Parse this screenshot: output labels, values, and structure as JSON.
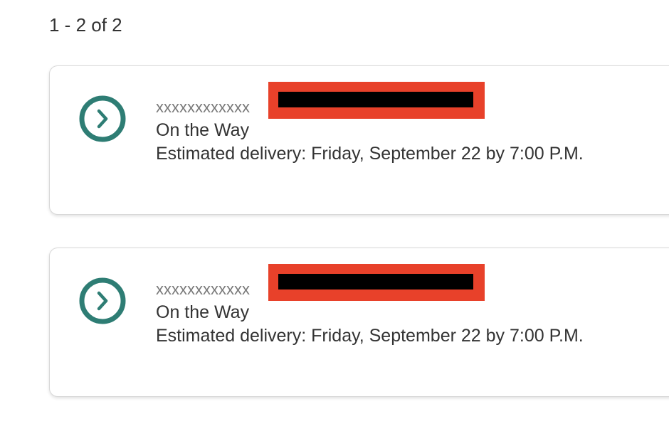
{
  "results": {
    "count_label": "1 - 2 of 2"
  },
  "shipments": [
    {
      "tracking_number": "xxxxxxxxxxxx",
      "status": "On the Way",
      "estimated_delivery": "Estimated delivery: Friday, September 22 by 7:00 P.M.",
      "open_icon": "chevron-right-circle-icon"
    },
    {
      "tracking_number": "xxxxxxxxxxxx",
      "status": "On the Way",
      "estimated_delivery": "Estimated delivery: Friday, September 22 by 7:00 P.M.",
      "open_icon": "chevron-right-circle-icon"
    }
  ],
  "colors": {
    "accent": "#2e7d74",
    "redaction_border": "#e8412a",
    "redaction_fill": "#000000"
  }
}
